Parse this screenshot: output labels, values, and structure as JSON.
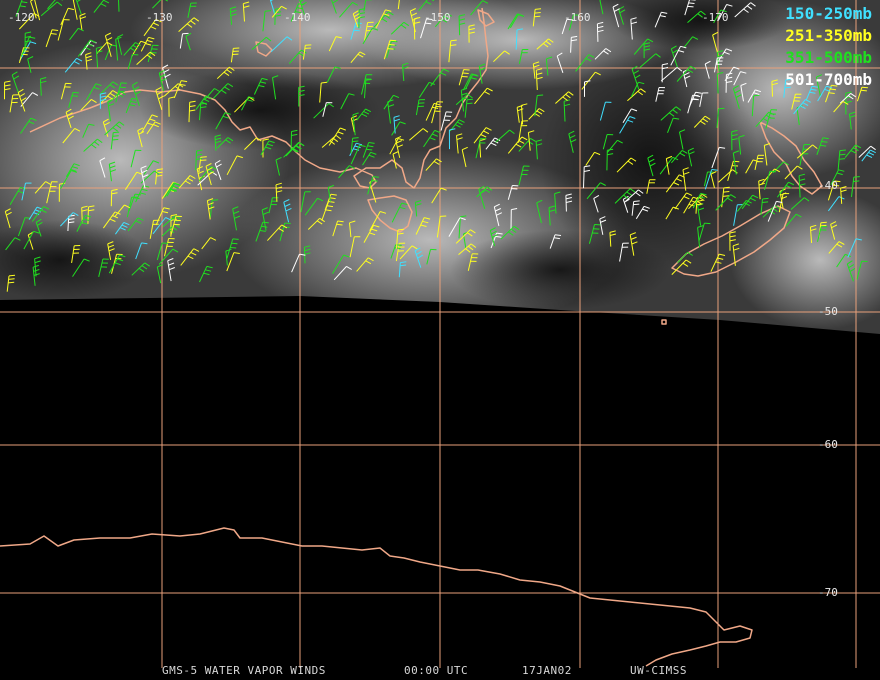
{
  "colors": {
    "grid": "#e8a07a",
    "coast": "#f0a888",
    "cloud_dark": "#2b2b2b",
    "cloud_light": "#c8c8c8",
    "background": "#000000"
  },
  "longitude_labels": [
    "-120",
    "-130",
    "-140",
    "-150",
    "-160",
    "-170"
  ],
  "latitude_labels": [
    "-40",
    "-50",
    "-60",
    "-70"
  ],
  "legend": [
    {
      "label": "150-250mb",
      "color": "#40e0ff"
    },
    {
      "label": "251-350mb",
      "color": "#ffff20"
    },
    {
      "label": "351-500mb",
      "color": "#20e020"
    },
    {
      "label": "501-700mb",
      "color": "#ffffff"
    }
  ],
  "footer": {
    "satellite": "GMS-5 WATER VAPOR WINDS",
    "time": "00:00 UTC",
    "date": "17JAN02",
    "source": "UW-CIMSS"
  }
}
